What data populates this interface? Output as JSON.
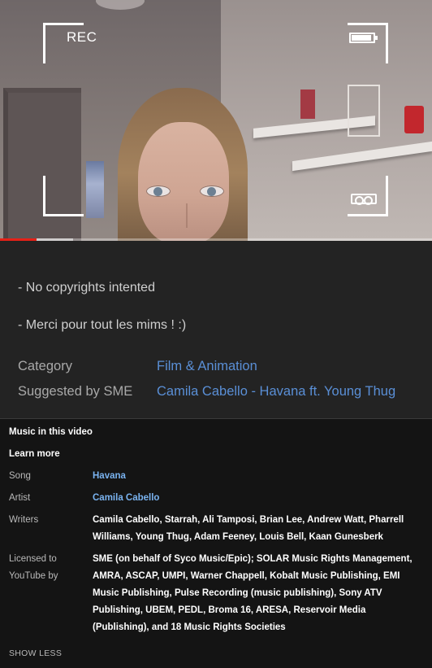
{
  "video": {
    "overlay": {
      "rec_label": "REC",
      "top_right_icon": "battery-icon",
      "bottom_right_icon": "tape-icon"
    },
    "progress": {
      "played_fraction": 0.085,
      "buffered_fraction": 0.17,
      "played_color": "#e62117"
    }
  },
  "description": {
    "lines": [
      "-  No copyrights intented",
      "- Merci pour tout les mims ! :)"
    ],
    "category_label": "Category",
    "category_value": "Film & Animation",
    "suggested_label": "Suggested by SME",
    "suggested_value": "Camila Cabello - Havana ft. Young Thug",
    "link_color": "#5a8fd6"
  },
  "music": {
    "title": "Music in this video",
    "learn_more": "Learn more",
    "song_label": "Song",
    "song_value": "Havana",
    "artist_label": "Artist",
    "artist_value": "Camila Cabello",
    "writers_label": "Writers",
    "writers_value": "Camila Cabello, Starrah, Ali Tamposi, Brian Lee, Andrew Watt, Pharrell Williams, Young Thug, Adam Feeney, Louis Bell, Kaan Gunesberk",
    "licensed_label": "Licensed to YouTube by",
    "licensed_value": "SME (on behalf of Syco Music/Epic); SOLAR Music Rights Management, AMRA, ASCAP, UMPI, Warner Chappell, Kobalt Music Publishing, EMI Music Publishing, Pulse Recording (music publishing), Sony ATV Publishing, UBEM, PEDL, Broma 16, ARESA, Reservoir Media (Publishing), and 18 Music Rights Societies",
    "show_less": "SHOW LESS"
  }
}
